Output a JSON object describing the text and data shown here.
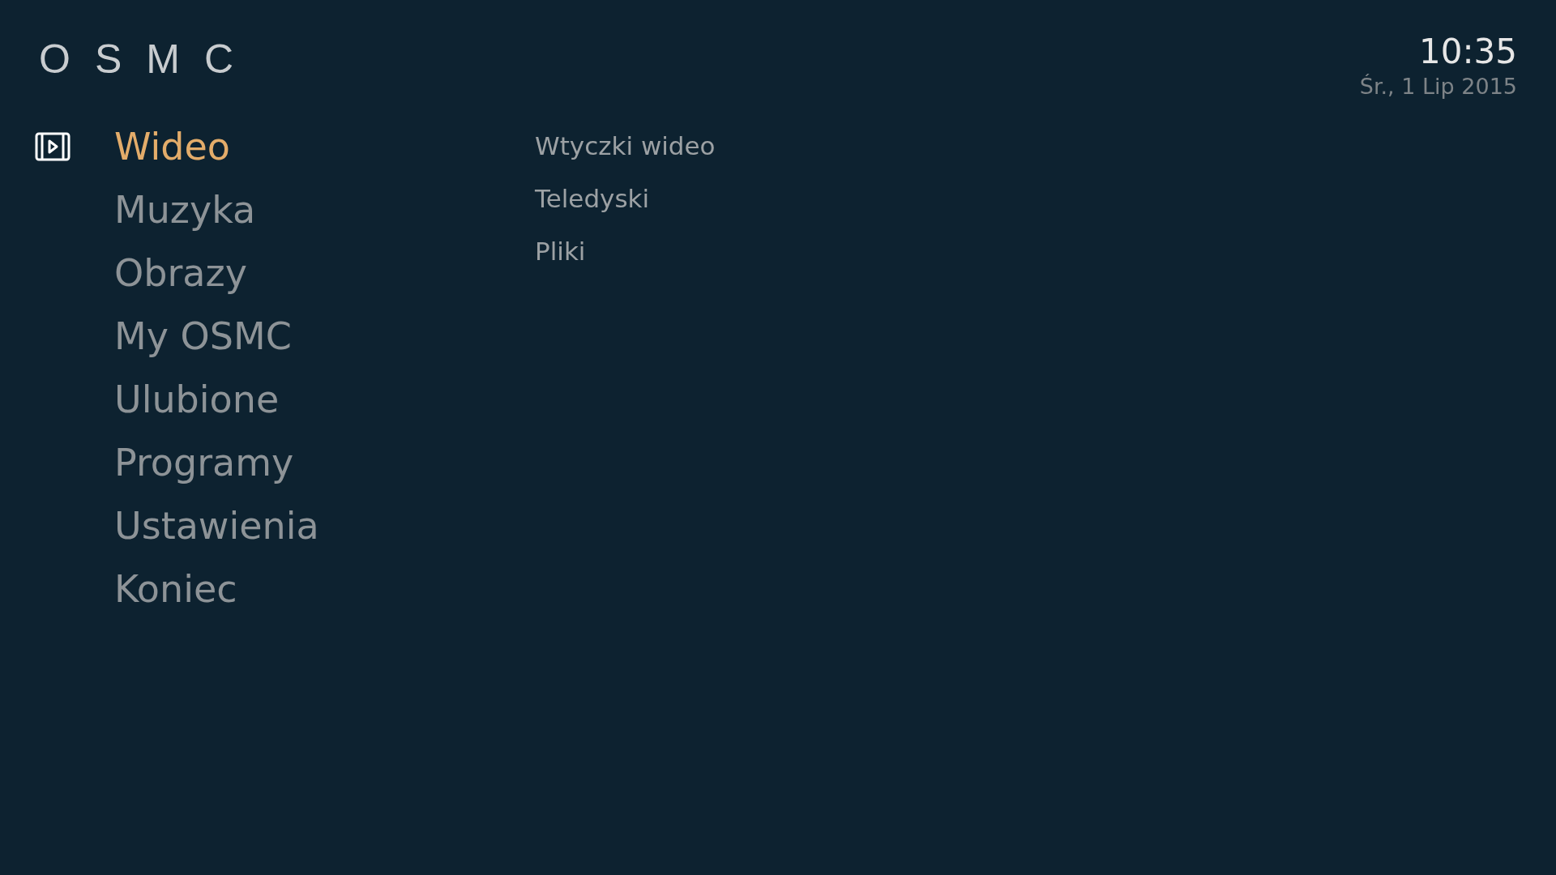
{
  "logo": "OSMC",
  "clock": {
    "time": "10:35",
    "date": "Śr., 1 Lip 2015"
  },
  "main_menu": [
    {
      "label": "Wideo",
      "selected": true
    },
    {
      "label": "Muzyka",
      "selected": false
    },
    {
      "label": "Obrazy",
      "selected": false
    },
    {
      "label": "My OSMC",
      "selected": false
    },
    {
      "label": "Ulubione",
      "selected": false
    },
    {
      "label": "Programy",
      "selected": false
    },
    {
      "label": "Ustawienia",
      "selected": false
    },
    {
      "label": "Koniec",
      "selected": false
    }
  ],
  "submenu": [
    "Wtyczki wideo",
    "Teledyski",
    "Pliki"
  ]
}
